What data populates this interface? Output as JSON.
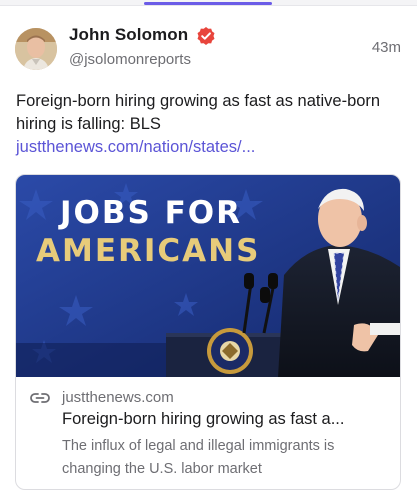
{
  "author": {
    "name": "John Solomon",
    "handle": "@jsolomonreports",
    "verified_icon": "verified-badge-icon",
    "avatar_icon": "avatar"
  },
  "post": {
    "timestamp": "43m",
    "text": "Foreign-born hiring growing as fast as native-born hiring is falling: BLS",
    "link_text": "justthenews.com/nation/states/..."
  },
  "card": {
    "image_text_line1": "JOBS FOR",
    "image_text_line2": "AMERICANS",
    "domain": "justthenews.com",
    "title": "Foreign-born hiring growing as fast a...",
    "description": "The influx of legal and illegal immigrants is changing the U.S. labor market"
  },
  "colors": {
    "accent": "#6b5ce7",
    "link": "#5b54d6",
    "verified": "#e8453c",
    "muted_text": "#6e6e73",
    "banner_gold": "#e7cb7a",
    "banner_blue": "#1f3a8f"
  }
}
